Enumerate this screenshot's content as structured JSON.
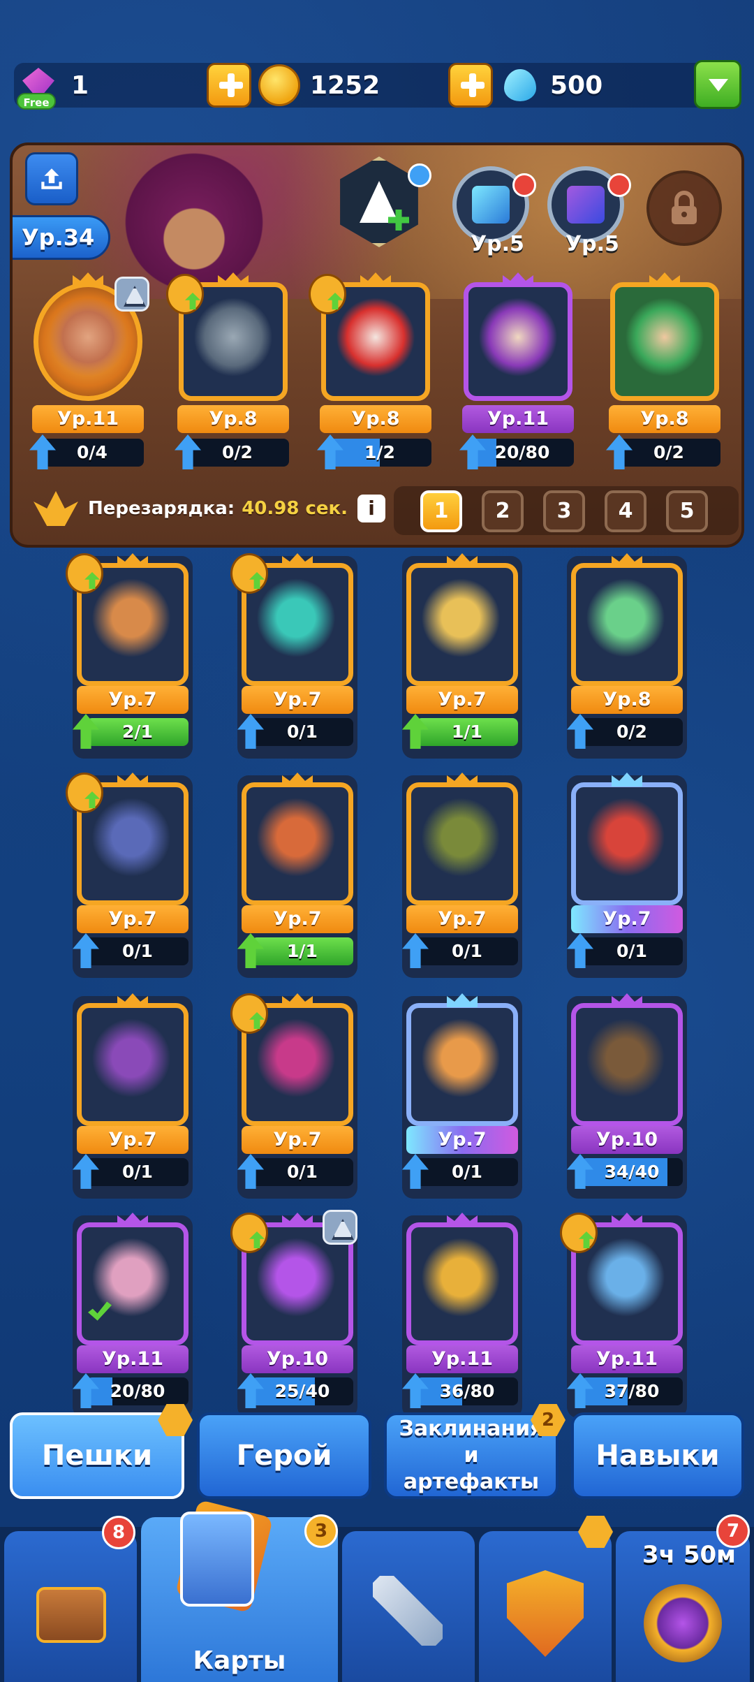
{
  "resources": {
    "gems": "1",
    "gems_badge": "Free",
    "coins": "1252",
    "mana": "500"
  },
  "hero": {
    "level": "Ур.34",
    "ability_levels": [
      "Ур.5",
      "Ур.5"
    ]
  },
  "deck": [
    {
      "level": "Ур.11",
      "progress": "0/4",
      "fill": 0,
      "rarity": "orange",
      "portrait": "monk-orb"
    },
    {
      "level": "Ур.8",
      "progress": "0/2",
      "fill": 0,
      "rarity": "orange",
      "portrait": "engineer"
    },
    {
      "level": "Ур.8",
      "progress": "1/2",
      "fill": 0.5,
      "rarity": "orange",
      "portrait": "jester-red"
    },
    {
      "level": "Ур.11",
      "progress": "20/80",
      "fill": 0.25,
      "rarity": "purple",
      "portrait": "harlequin"
    },
    {
      "level": "Ур.8",
      "progress": "0/2",
      "fill": 0,
      "rarity": "orange",
      "portrait": "dryad"
    }
  ],
  "recharge": {
    "label": "Перезарядка:",
    "time": "40.98 сек.",
    "info": "i"
  },
  "deck_tabs": [
    "1",
    "2",
    "3",
    "4",
    "5"
  ],
  "collection": [
    {
      "level": "Ур.7",
      "progress": "2/1",
      "fill": 1,
      "green": true,
      "rarity": "orange",
      "badge": "sword"
    },
    {
      "level": "Ур.7",
      "progress": "0/1",
      "fill": 0,
      "green": false,
      "rarity": "orange",
      "badge": "sword"
    },
    {
      "level": "Ур.7",
      "progress": "1/1",
      "fill": 1,
      "green": true,
      "rarity": "orange",
      "badge": ""
    },
    {
      "level": "Ур.8",
      "progress": "0/2",
      "fill": 0,
      "green": false,
      "rarity": "orange",
      "badge": ""
    },
    {
      "level": "Ур.7",
      "progress": "0/1",
      "fill": 0,
      "green": false,
      "rarity": "orange",
      "badge": "sword"
    },
    {
      "level": "Ур.7",
      "progress": "1/1",
      "fill": 1,
      "green": true,
      "rarity": "orange",
      "badge": ""
    },
    {
      "level": "Ур.7",
      "progress": "0/1",
      "fill": 0,
      "green": false,
      "rarity": "orange",
      "badge": ""
    },
    {
      "level": "Ур.7",
      "progress": "0/1",
      "fill": 0,
      "green": false,
      "rarity": "blue",
      "badge": ""
    },
    {
      "level": "Ур.7",
      "progress": "0/1",
      "fill": 0,
      "green": false,
      "rarity": "orange",
      "badge": ""
    },
    {
      "level": "Ур.7",
      "progress": "0/1",
      "fill": 0,
      "green": false,
      "rarity": "orange",
      "badge": "sword"
    },
    {
      "level": "Ур.7",
      "progress": "0/1",
      "fill": 0,
      "green": false,
      "rarity": "blue",
      "badge": ""
    },
    {
      "level": "Ур.10",
      "progress": "34/40",
      "fill": 0.85,
      "green": false,
      "rarity": "purple",
      "badge": ""
    },
    {
      "level": "Ур.11",
      "progress": "20/80",
      "fill": 0.25,
      "green": false,
      "rarity": "purple",
      "badge": ""
    },
    {
      "level": "Ур.10",
      "progress": "25/40",
      "fill": 0.62,
      "green": false,
      "rarity": "purple",
      "badge": "sword"
    },
    {
      "level": "Ур.11",
      "progress": "36/80",
      "fill": 0.45,
      "green": false,
      "rarity": "purple",
      "badge": ""
    },
    {
      "level": "Ур.11",
      "progress": "37/80",
      "fill": 0.46,
      "green": false,
      "rarity": "purple",
      "badge": "sword"
    }
  ],
  "categories": [
    {
      "label": "Пешки",
      "active": true
    },
    {
      "label": "Герой",
      "active": false
    },
    {
      "label": "Заклинания и артефакты",
      "badge": "2",
      "active": false
    },
    {
      "label": "Навыки",
      "active": false
    }
  ],
  "nav": {
    "chest_badge": "8",
    "cards_label": "Карты",
    "cards_badge": "3",
    "event_timer": "3ч 50м",
    "event_badge": "7"
  },
  "colors": {
    "orange": "#f5a623",
    "purple": "#b455e8",
    "blue": "#7fd4ff",
    "accent": "#2f8ae8"
  }
}
